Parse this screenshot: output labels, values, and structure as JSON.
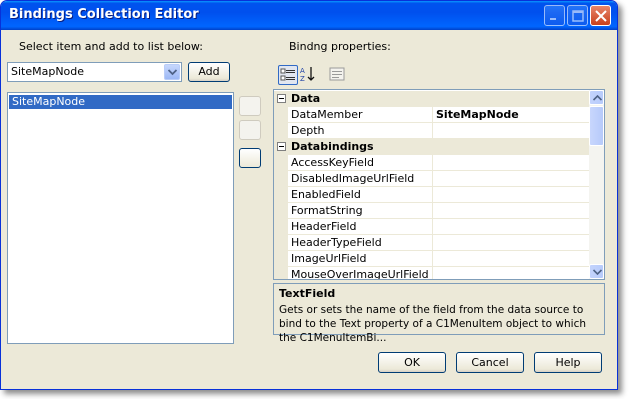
{
  "window": {
    "title": "Bindings Collection Editor"
  },
  "left": {
    "label": "Select item and add to list below:",
    "combo_value": "SiteMapNode",
    "add_label": "Add",
    "list_items": [
      "SiteMapNode"
    ]
  },
  "right": {
    "label": "Bindng properties:",
    "categories": [
      {
        "name": "Data",
        "rows": [
          {
            "name": "DataMember",
            "value": "SiteMapNode"
          },
          {
            "name": "Depth",
            "value": ""
          }
        ]
      },
      {
        "name": "Databindings",
        "rows": [
          {
            "name": "AccessKeyField",
            "value": ""
          },
          {
            "name": "DisabledImageUrlField",
            "value": ""
          },
          {
            "name": "EnabledField",
            "value": ""
          },
          {
            "name": "FormatString",
            "value": ""
          },
          {
            "name": "HeaderField",
            "value": ""
          },
          {
            "name": "HeaderTypeField",
            "value": ""
          },
          {
            "name": "ImageUrlField",
            "value": ""
          },
          {
            "name": "MouseOverImageUrlField",
            "value": ""
          }
        ]
      }
    ],
    "description": {
      "title": "TextField",
      "text": "Gets or sets the name of the field from the data source to bind to the Text property of a C1MenuItem object to which the C1MenuItemBi..."
    }
  },
  "footer": {
    "ok": "OK",
    "cancel": "Cancel",
    "help": "Help"
  },
  "icons": [
    "minimize-icon",
    "maximize-icon",
    "close-icon",
    "dropdown-arrow-icon",
    "categorized-icon",
    "alphabetical-icon",
    "property-pages-icon",
    "collapse-icon"
  ],
  "colors": {
    "title_bar": "#0053ee",
    "selection": "#316ac5",
    "dialog_bg": "#ece9d8",
    "close_button": "#c8401c"
  }
}
